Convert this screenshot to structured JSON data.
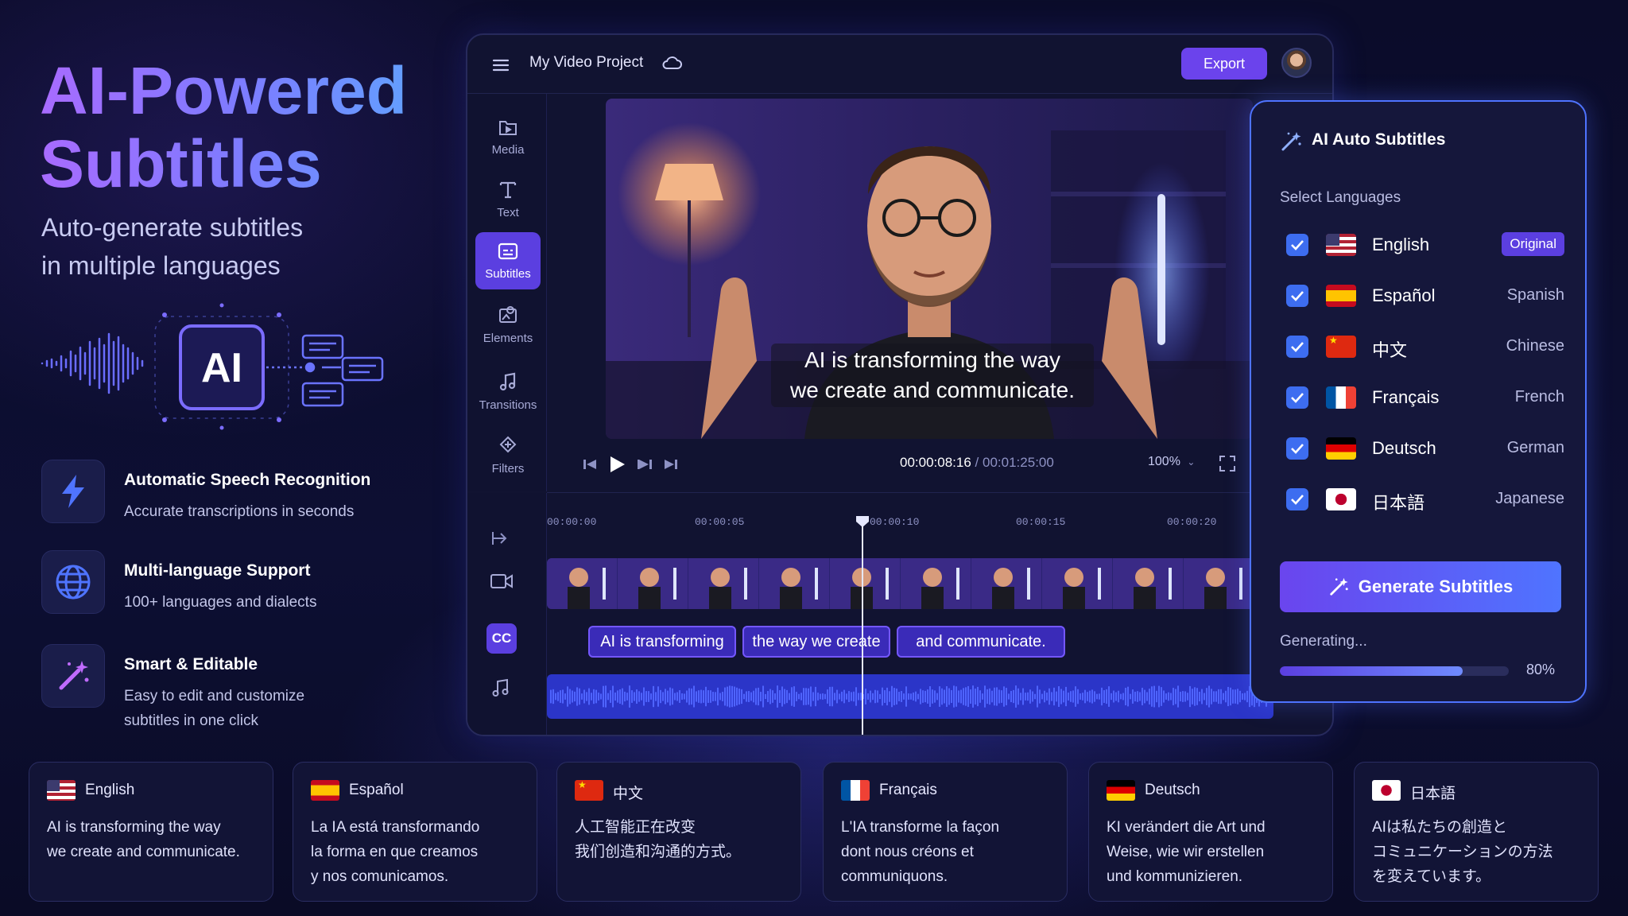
{
  "hero": {
    "title_line1": "AI-Powered",
    "title_line2": "Subtitles",
    "subtitle_line1": "Auto-generate subtitles",
    "subtitle_line2": "in multiple languages",
    "ai_badge": "AI"
  },
  "features": [
    {
      "icon": "lightning-icon",
      "title": "Automatic Speech Recognition",
      "desc_line1": "Accurate transcriptions in seconds",
      "desc_line2": ""
    },
    {
      "icon": "globe-icon",
      "title": "Multi-language Support",
      "desc_line1": "100+ languages and dialects",
      "desc_line2": ""
    },
    {
      "icon": "magic-wand-icon",
      "title": "Smart & Editable",
      "desc_line1": "Easy to edit and customize",
      "desc_line2": "subtitles in one click"
    }
  ],
  "editor": {
    "project_title": "My Video Project",
    "export_label": "Export",
    "tools": [
      {
        "label": "Media",
        "icon": "media-icon"
      },
      {
        "label": "Text",
        "icon": "text-icon"
      },
      {
        "label": "Subtitles",
        "icon": "subtitles-icon",
        "active": true
      },
      {
        "label": "Elements",
        "icon": "elements-icon"
      },
      {
        "label": "Transitions",
        "icon": "transitions-icon"
      },
      {
        "label": "Filters",
        "icon": "filters-icon"
      }
    ],
    "overlay_line1": "AI is transforming the way",
    "overlay_line2": "we create and communicate.",
    "current_time": "00:00:08:16",
    "separator": "/",
    "total_time": "00:01:25:00",
    "zoom": "100%",
    "ruler": [
      "00:00:00",
      "00:00:05",
      "00:00:10",
      "00:00:15",
      "00:00:20"
    ],
    "cc_label": "CC",
    "subtitle_clips": [
      "AI is transforming",
      "the way we create",
      "and communicate."
    ]
  },
  "ai_panel": {
    "title": "AI Auto Subtitles",
    "select_label": "Select Languages",
    "languages": [
      {
        "name": "English",
        "tag": "Original",
        "flag": "us",
        "checked": true,
        "is_original": true
      },
      {
        "name": "Español",
        "tag": "Spanish",
        "flag": "es",
        "checked": true
      },
      {
        "name": "中文",
        "tag": "Chinese",
        "flag": "cn",
        "checked": true
      },
      {
        "name": "Français",
        "tag": "French",
        "flag": "fr",
        "checked": true
      },
      {
        "name": "Deutsch",
        "tag": "German",
        "flag": "de",
        "checked": true
      },
      {
        "name": "日本語",
        "tag": "Japanese",
        "flag": "jp",
        "checked": true
      }
    ],
    "generate_label": "Generate Subtitles",
    "status": "Generating...",
    "progress": 0.8,
    "progress_label": "80%"
  },
  "cards": [
    {
      "lang": "English",
      "flag": "us",
      "line1": "AI is transforming the way",
      "line2": "we create and communicate.",
      "line3": ""
    },
    {
      "lang": "Español",
      "flag": "es",
      "line1": "La IA está transformando",
      "line2": "la forma en que creamos",
      "line3": "y nos comunicamos."
    },
    {
      "lang": "中文",
      "flag": "cn",
      "line1": "人工智能正在改变",
      "line2": "我们创造和沟通的方式。",
      "line3": ""
    },
    {
      "lang": "Français",
      "flag": "fr",
      "line1": "L'IA transforme la façon",
      "line2": "dont nous créons et",
      "line3": "communiquons."
    },
    {
      "lang": "Deutsch",
      "flag": "de",
      "line1": "KI verändert die Art und",
      "line2": "Weise, wie wir erstellen",
      "line3": "und kommunizieren."
    },
    {
      "lang": "日本語",
      "flag": "jp",
      "line1": "AIは私たちの創造と",
      "line2": "コミュニケーションの方法",
      "line3": "を変えています。"
    }
  ],
  "colors": {
    "accent_purple": "#6b43ec",
    "accent_blue": "#4f74ff",
    "checkbox_blue": "#3d6df0",
    "background": "#0b0c2a"
  }
}
